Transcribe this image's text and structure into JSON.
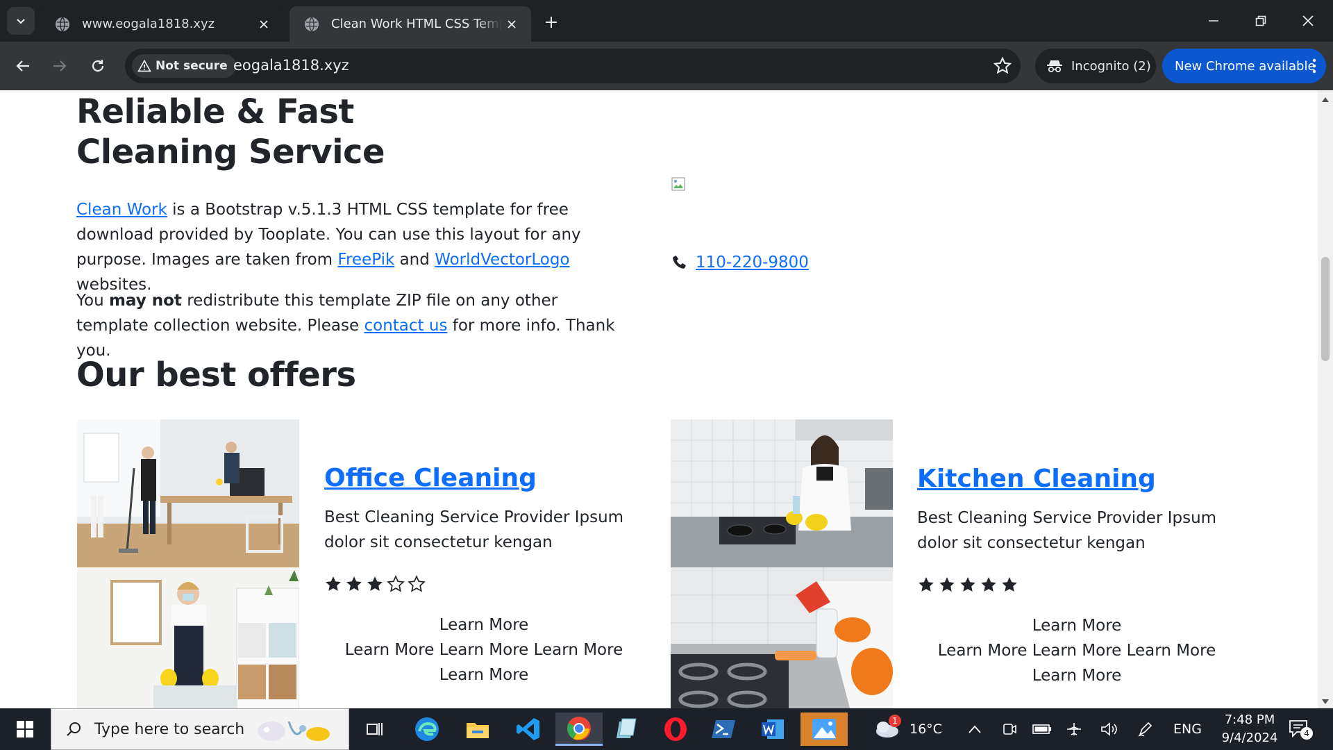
{
  "browser": {
    "tabs": [
      {
        "title": "www.eogala1818.xyz",
        "active": false
      },
      {
        "title": "Clean Work HTML CSS Template",
        "active": true
      }
    ],
    "security_label": "Not secure",
    "url": "eogala1818.xyz",
    "incognito_label": "Incognito (2)",
    "update_label": "New Chrome available"
  },
  "page": {
    "hero_title": "Reliable & Fast Cleaning Service",
    "intro": {
      "link_clean_work": "Clean Work",
      "text_a": " is a Bootstrap v.5.1.3 HTML CSS template for free download provided by Tooplate. You can use this layout for any purpose. Images are taken from ",
      "link_freepik": "FreePik",
      "text_b": " and ",
      "link_wvl": "WorldVectorLogo",
      "text_c": " websites."
    },
    "notice": {
      "text_a": "You ",
      "bold": "may not",
      "text_b": " redistribute this template ZIP file on any other template collection website. Please ",
      "link_contact": "contact us",
      "text_c": " for more info. Thank you."
    },
    "phone": "110-220-9800",
    "offers_title": "Our best offers",
    "offers": [
      {
        "title": "Office Cleaning",
        "description": "Best Cleaning Service Provider Ipsum dolor sit consectetur kengan",
        "rating": 3,
        "rating_max": 5,
        "links_line1": "Learn More",
        "links_line2": "Learn More Learn More Learn More",
        "links_line3": "Learn More"
      },
      {
        "title": "Kitchen Cleaning",
        "description": "Best Cleaning Service Provider Ipsum dolor sit consectetur kengan",
        "rating": 5,
        "rating_max": 5,
        "links_line1": "Learn More",
        "links_line2": "Learn More Learn More Learn More",
        "links_line3": "Learn More"
      }
    ]
  },
  "taskbar": {
    "search_placeholder": "Type here to search",
    "weather_temp": "16°C",
    "weather_badge": "1",
    "language": "ENG",
    "time": "7:48 PM",
    "date": "9/4/2024",
    "notification_count": "4"
  }
}
